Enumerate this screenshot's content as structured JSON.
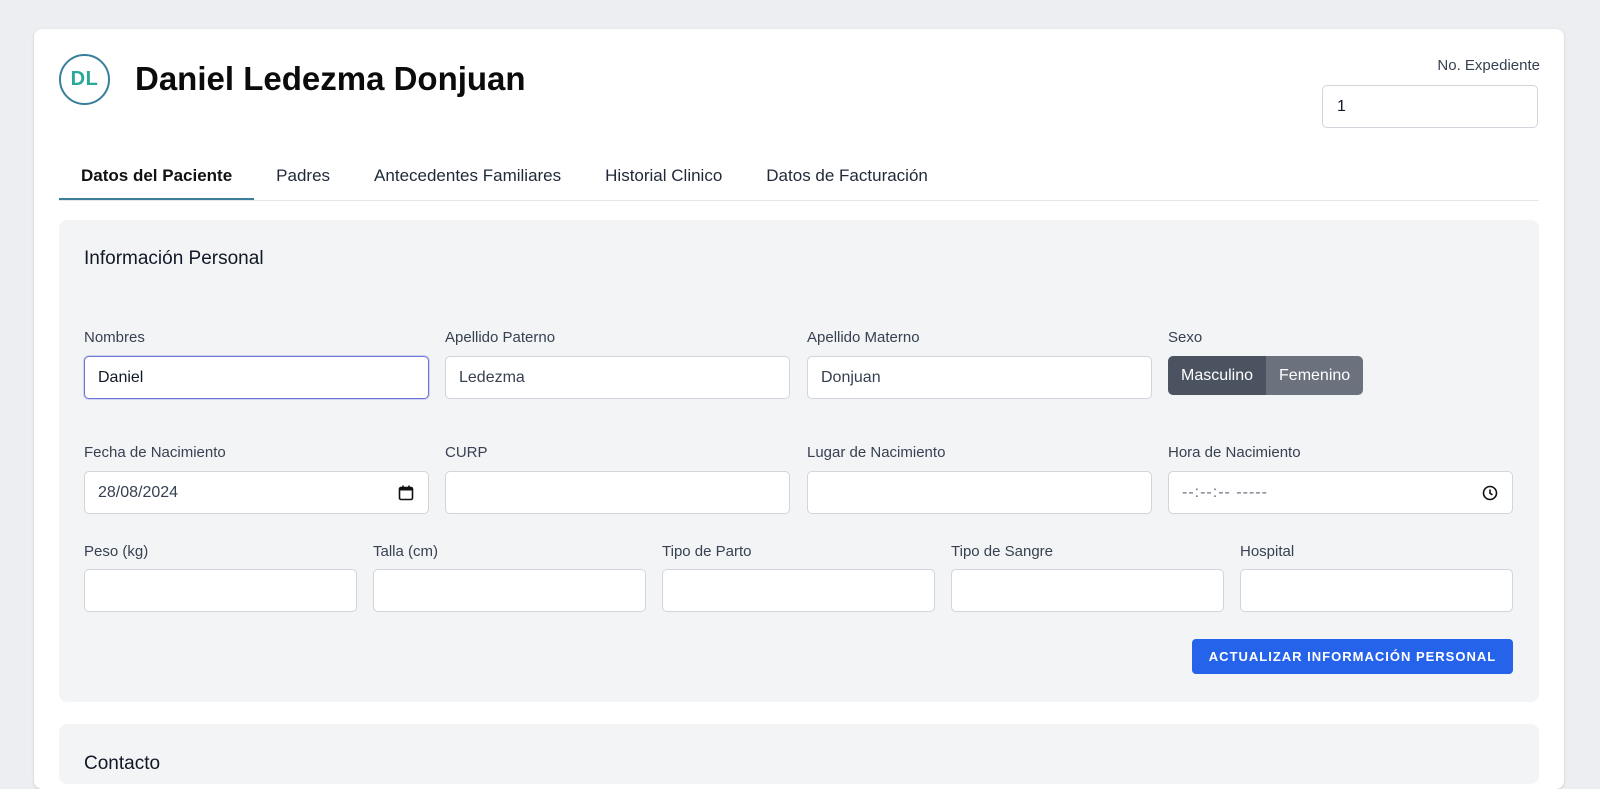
{
  "patient": {
    "initials": "DL",
    "name": "Daniel Ledezma Donjuan",
    "expediente_label": "No. Expediente",
    "expediente_value": "1"
  },
  "tabs": [
    {
      "label": "Datos del Paciente",
      "active": true
    },
    {
      "label": "Padres",
      "active": false
    },
    {
      "label": "Antecedentes Familiares",
      "active": false
    },
    {
      "label": "Historial Clinico",
      "active": false
    },
    {
      "label": "Datos de Facturación",
      "active": false
    }
  ],
  "personal": {
    "title": "Información Personal",
    "nombres": {
      "label": "Nombres",
      "value": "Daniel"
    },
    "apellido_paterno": {
      "label": "Apellido Paterno",
      "value": "Ledezma"
    },
    "apellido_materno": {
      "label": "Apellido Materno",
      "value": "Donjuan"
    },
    "sexo": {
      "label": "Sexo",
      "options": [
        "Masculino",
        "Femenino"
      ],
      "selected": "Masculino"
    },
    "fecha_nacimiento": {
      "label": "Fecha de Nacimiento",
      "value": "28/08/2024"
    },
    "curp": {
      "label": "CURP",
      "value": ""
    },
    "lugar_nacimiento": {
      "label": "Lugar de Nacimiento",
      "value": ""
    },
    "hora_nacimiento": {
      "label": "Hora de Nacimiento",
      "placeholder": "--:--:-- -----"
    },
    "peso": {
      "label": "Peso (kg)",
      "value": ""
    },
    "talla": {
      "label": "Talla (cm)",
      "value": ""
    },
    "tipo_parto": {
      "label": "Tipo de Parto",
      "value": ""
    },
    "tipo_sangre": {
      "label": "Tipo de Sangre",
      "value": ""
    },
    "hospital": {
      "label": "Hospital",
      "value": ""
    },
    "update_button": "ACTUALIZAR INFORMACIÓN PERSONAL"
  },
  "contact": {
    "title": "Contacto"
  },
  "icons": {
    "calendar": "calendar-icon",
    "clock": "clock-icon"
  },
  "colors": {
    "accent": "#3a7f9a",
    "avatar_text": "#2aa99a",
    "primary_button": "#2563eb",
    "sex_selected": "#4b5360",
    "sex_unselected": "#6b727d"
  }
}
